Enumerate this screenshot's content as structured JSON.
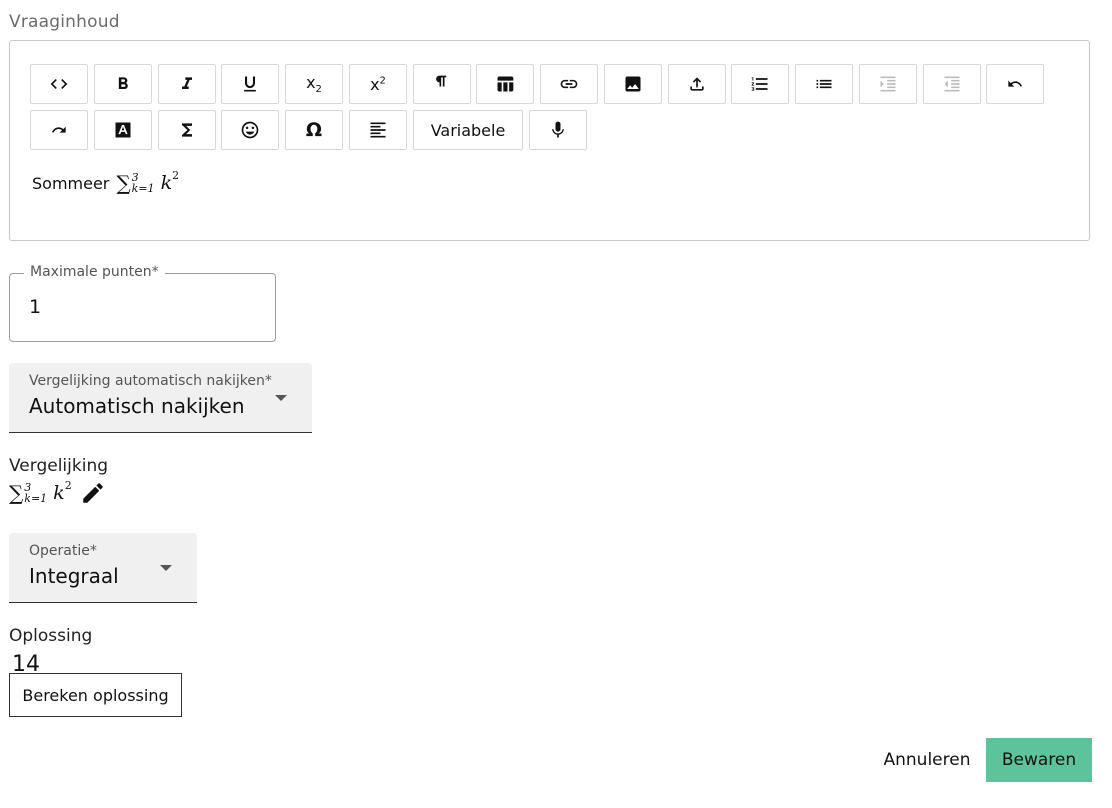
{
  "question_content": {
    "section_label": "Vraaginhoud",
    "toolbar": [
      {
        "name": "code-icon",
        "label": "",
        "disabled": false
      },
      {
        "name": "bold-icon",
        "label": "",
        "disabled": false
      },
      {
        "name": "italic-icon",
        "label": "",
        "disabled": false
      },
      {
        "name": "underline-icon",
        "label": "",
        "disabled": false
      },
      {
        "name": "subscript-icon",
        "label": "",
        "disabled": false
      },
      {
        "name": "superscript-icon",
        "label": "",
        "disabled": false
      },
      {
        "name": "paragraph-icon",
        "label": "",
        "disabled": false
      },
      {
        "name": "table-icon",
        "label": "",
        "disabled": false
      },
      {
        "name": "link-icon",
        "label": "",
        "disabled": false
      },
      {
        "name": "image-icon",
        "label": "",
        "disabled": false
      },
      {
        "name": "upload-icon",
        "label": "",
        "disabled": false
      },
      {
        "name": "numbered-list-icon",
        "label": "",
        "disabled": false
      },
      {
        "name": "bulleted-list-icon",
        "label": "",
        "disabled": false
      },
      {
        "name": "indent-increase-icon",
        "label": "",
        "disabled": true
      },
      {
        "name": "indent-decrease-icon",
        "label": "",
        "disabled": true
      },
      {
        "name": "undo-icon",
        "label": "",
        "disabled": false
      },
      {
        "name": "redo-icon",
        "label": "",
        "disabled": false
      },
      {
        "name": "text-color-icon",
        "label": "",
        "disabled": false
      },
      {
        "name": "sigma-icon",
        "label": "",
        "disabled": false
      },
      {
        "name": "emoji-icon",
        "label": "",
        "disabled": false
      },
      {
        "name": "omega-icon",
        "label": "",
        "disabled": false
      },
      {
        "name": "align-left-icon",
        "label": "",
        "disabled": false
      },
      {
        "name": "variable-button",
        "label": "Variabele",
        "disabled": false
      },
      {
        "name": "microphone-icon",
        "label": "",
        "disabled": false
      }
    ],
    "text": "Sommeer",
    "math": {
      "sum": "∑",
      "upper": "3",
      "lower": "k=1",
      "var": "k",
      "power": "2"
    }
  },
  "max_points": {
    "label": "Maximale punten*",
    "value": "1"
  },
  "auto_grading": {
    "label": "Vergelijking automatisch nakijken*",
    "value": "Automatisch nakijken"
  },
  "equation": {
    "label": "Vergelijking",
    "math": {
      "sum": "∑",
      "upper": "3",
      "lower": "k=1",
      "var": "k",
      "power": "2"
    }
  },
  "operation": {
    "label": "Operatie*",
    "value": "Integraal"
  },
  "solution": {
    "label": "Oplossing",
    "value": "14",
    "calculate_label": "Bereken oplossing"
  },
  "actions": {
    "cancel_label": "Annuleren",
    "save_label": "Bewaren",
    "save_color": "#5cc39a"
  }
}
